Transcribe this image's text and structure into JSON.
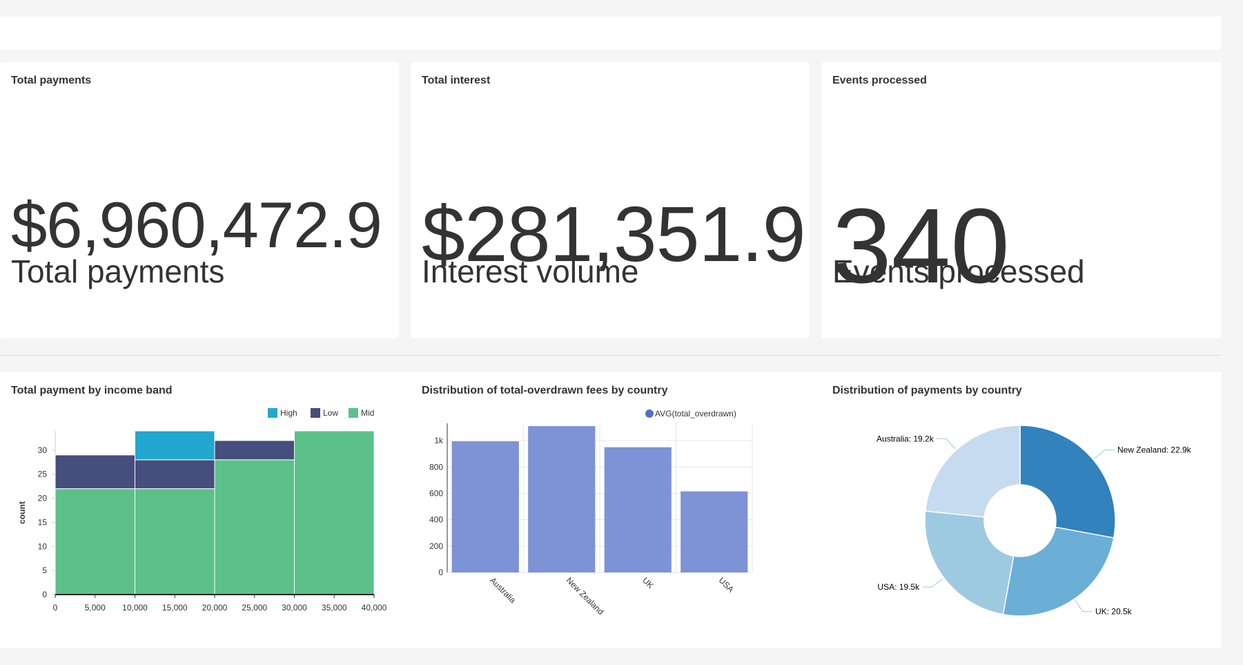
{
  "kpis": [
    {
      "title": "Total payments",
      "value": "$6,960,472.9",
      "subtitle": "Total payments"
    },
    {
      "title": "Total interest",
      "value": "$281,351.9",
      "subtitle": "Interest volume"
    },
    {
      "title": "Events processed",
      "value": "340",
      "subtitle": "Events processed"
    }
  ],
  "charts": {
    "histogram_title": "Total payment by income band",
    "bar_title": "Distribution of total-overdrawn fees by country",
    "pie_title": "Distribution of payments by country"
  },
  "colors": {
    "high": "#22a7ce",
    "low": "#454e7c",
    "mid": "#5bc189",
    "bar": "#7d93d6",
    "legend_dot": "#5470c6",
    "pie": [
      "#3182bd",
      "#6baed6",
      "#9ecae1",
      "#c6dbef"
    ]
  },
  "chart_data": [
    {
      "type": "bar",
      "subtype": "stacked-histogram",
      "title": "Total payment by income band",
      "ylabel": "count",
      "xlim": [
        0,
        40000
      ],
      "ylim": [
        0,
        34
      ],
      "x_ticks": [
        "0",
        "5,000",
        "10,000",
        "15,000",
        "20,000",
        "25,000",
        "30,000",
        "35,000",
        "40,000"
      ],
      "y_ticks": [
        "0",
        "5",
        "10",
        "15",
        "20",
        "25",
        "30"
      ],
      "bins": [
        [
          0,
          10000
        ],
        [
          10000,
          20000
        ],
        [
          20000,
          30000
        ],
        [
          30000,
          40000
        ]
      ],
      "series": [
        {
          "name": "Mid",
          "values": [
            22,
            22,
            28,
            34
          ]
        },
        {
          "name": "Low",
          "values": [
            7,
            6,
            4,
            0
          ]
        },
        {
          "name": "High",
          "values": [
            0,
            6,
            0,
            0
          ]
        }
      ],
      "legend": [
        "High",
        "Low",
        "Mid"
      ],
      "legend_position": "top-right"
    },
    {
      "type": "bar",
      "title": "Distribution of total-overdrawn fees by country",
      "categories": [
        "Australia",
        "New Zealand",
        "UK",
        "USA"
      ],
      "series": [
        {
          "name": "AVG(total_overdrawn)",
          "values": [
            995,
            1110,
            950,
            615
          ]
        }
      ],
      "ylim": [
        0,
        1100
      ],
      "y_ticks": [
        "0",
        "200",
        "400",
        "600",
        "800",
        "1k"
      ],
      "legend_position": "top-right",
      "grid": true
    },
    {
      "type": "pie",
      "subtype": "donut",
      "title": "Distribution of payments by country",
      "labels": [
        "New Zealand",
        "UK",
        "USA",
        "Australia"
      ],
      "values": [
        22.9,
        20.5,
        19.5,
        19.2
      ],
      "label_texts": [
        "New Zealand: 22.9k",
        "UK: 20.5k",
        "USA: 19.5k",
        "Australia: 19.2k"
      ]
    }
  ]
}
